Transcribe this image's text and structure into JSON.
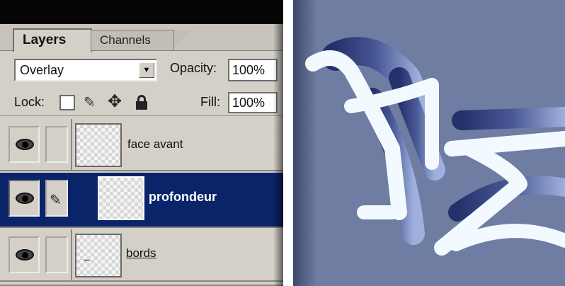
{
  "palette": {
    "tabs": {
      "layers": "Layers",
      "channels": "Channels"
    },
    "blend_mode": "Overlay",
    "opacity_label": "Opacity:",
    "opacity_value": "100%",
    "lock_label": "Lock:",
    "fill_label": "Fill:",
    "fill_value": "100%",
    "layers": [
      {
        "name": "face avant",
        "visible": true,
        "selected": false
      },
      {
        "name": "profondeur",
        "visible": true,
        "selected": true,
        "brush_icon": "brush-icon"
      },
      {
        "name": "bords",
        "visible": true,
        "selected": false
      }
    ],
    "icons": [
      "eye-icon",
      "brush-icon",
      "lock-transparency-icon",
      "move-icon",
      "lock-icon",
      "dropdown-arrow-icon"
    ]
  },
  "colors": {
    "panel_bg": "#d4d0c8",
    "selection": "#0a246a",
    "canvas_bg": "#6f7da2",
    "stroke_dark": "#2e3a6a",
    "stroke_light": "#f2faff"
  }
}
